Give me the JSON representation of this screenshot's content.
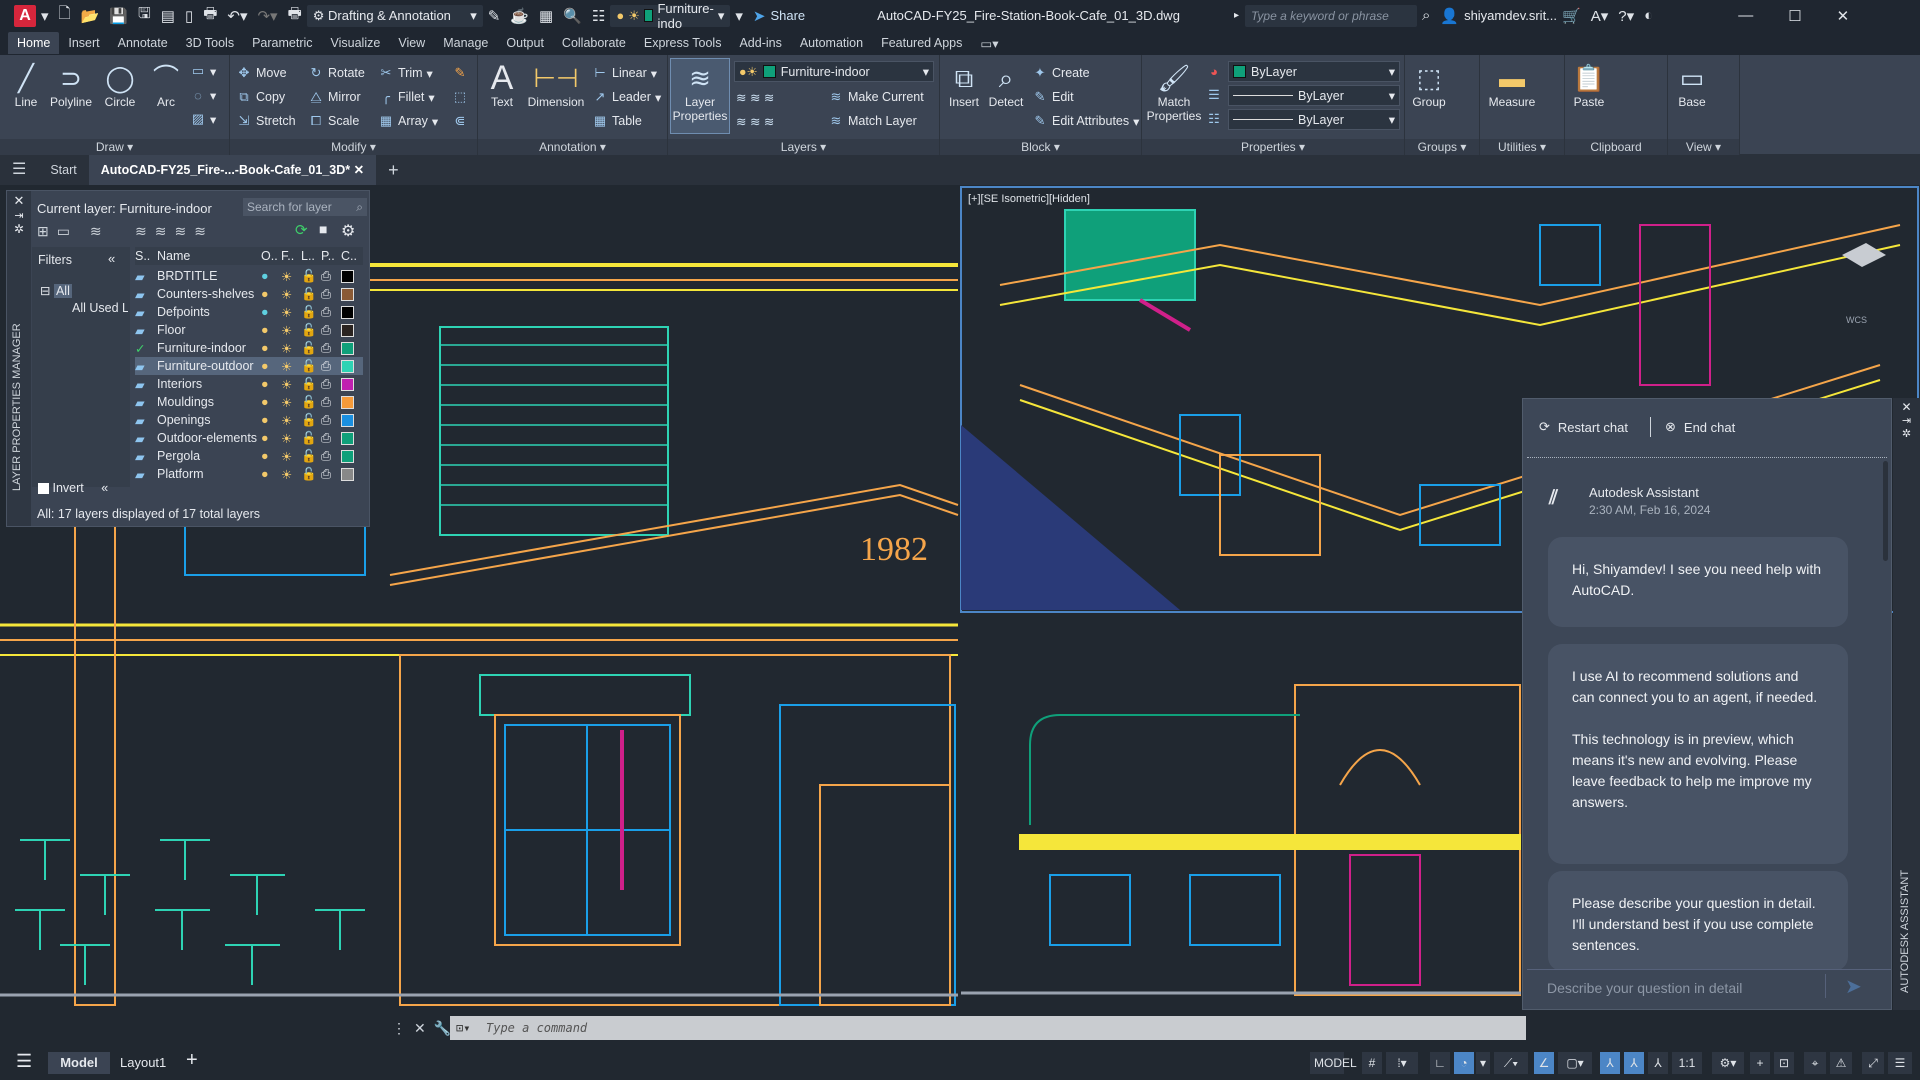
{
  "app": {
    "logo": "A",
    "workspace": "Drafting & Annotation",
    "layer_quick": "Furniture-indo",
    "share": "Share",
    "file_title": "AutoCAD-FY25_Fire-Station-Book-Cafe_01_3D.dwg",
    "search_placeholder": "Type a keyword or phrase",
    "user": "shiyamdev.srit..."
  },
  "ribbon_tabs": [
    "Home",
    "Insert",
    "Annotate",
    "3D Tools",
    "Parametric",
    "Visualize",
    "View",
    "Manage",
    "Output",
    "Collaborate",
    "Express Tools",
    "Add-ins",
    "Automation",
    "Featured Apps"
  ],
  "ribbon": {
    "draw": {
      "label": "Draw",
      "line": "Line",
      "polyline": "Polyline",
      "circle": "Circle",
      "arc": "Arc"
    },
    "modify": {
      "label": "Modify",
      "move": "Move",
      "rotate": "Rotate",
      "trim": "Trim",
      "copy": "Copy",
      "mirror": "Mirror",
      "fillet": "Fillet",
      "stretch": "Stretch",
      "scale": "Scale",
      "array": "Array"
    },
    "annotation": {
      "label": "Annotation",
      "text": "Text",
      "dimension": "Dimension",
      "linear": "Linear",
      "leader": "Leader",
      "table": "Table"
    },
    "layers": {
      "label": "Layers",
      "layer_properties": "Layer Properties",
      "current_layer": "Furniture-indoor",
      "make_current": "Make Current",
      "match_layer": "Match Layer"
    },
    "block": {
      "label": "Block",
      "insert": "Insert",
      "detect": "Detect",
      "create": "Create",
      "edit": "Edit",
      "edit_attributes": "Edit Attributes"
    },
    "properties": {
      "label": "Properties",
      "match_properties": "Match Properties",
      "color": "ByLayer",
      "linetype": "ByLayer",
      "lineweight": "ByLayer"
    },
    "groups": {
      "label": "Groups",
      "group": "Group"
    },
    "utilities": {
      "label": "Utilities",
      "measure": "Measure"
    },
    "clipboard": {
      "label": "Clipboard",
      "paste": "Paste"
    },
    "view": {
      "label": "View",
      "base": "Base"
    }
  },
  "doc_tabs": {
    "start": "Start",
    "active": "AutoCAD-FY25_Fire-...-Book-Cafe_01_3D*"
  },
  "layer_manager": {
    "side_title": "LAYER PROPERTIES MANAGER",
    "current_layer": "Current layer: Furniture-indoor",
    "search_placeholder": "Search for layer",
    "filters_label": "Filters",
    "filter_all": "All",
    "filter_all_used": "All Used Layers",
    "invert": "Invert",
    "columns": [
      "S..",
      "Name",
      "O..",
      "F..",
      "L..",
      "P..",
      "C.."
    ],
    "layers": [
      {
        "name": "BRDTITLE",
        "color": "#000000",
        "on_color": "#5fd0e0"
      },
      {
        "name": "Counters-shelves",
        "color": "#8a5a35",
        "on_color": "#f3c96a"
      },
      {
        "name": "Defpoints",
        "color": "#000000",
        "on_color": "#5fd0e0"
      },
      {
        "name": "Floor",
        "color": "#2a2320",
        "on_color": "#f3c96a"
      },
      {
        "name": "Furniture-indoor",
        "color": "#0fa07a",
        "on_color": "#f3c96a",
        "current": true
      },
      {
        "name": "Furniture-outdoor",
        "color": "#2ed3b4",
        "on_color": "#f3c96a",
        "selected": true
      },
      {
        "name": "Interiors",
        "color": "#c020b0",
        "on_color": "#f3c96a"
      },
      {
        "name": "Mouldings",
        "color": "#f59a3a",
        "on_color": "#f3c96a"
      },
      {
        "name": "Openings",
        "color": "#1a8fe0",
        "on_color": "#f3c96a"
      },
      {
        "name": "Outdoor-elements",
        "color": "#0fa07a",
        "on_color": "#f3c96a"
      },
      {
        "name": "Pergola",
        "color": "#0fa07a",
        "on_color": "#f3c96a"
      },
      {
        "name": "Platform",
        "color": "#888888",
        "on_color": "#f3c96a"
      }
    ],
    "status": "All: 17 layers displayed of 17 total layers"
  },
  "viewports": {
    "iso_label": "[+][SE Isometric][Hidden]",
    "wcs": "WCS",
    "year_text": "1982"
  },
  "chat": {
    "restart": "Restart chat",
    "end": "End chat",
    "sender": "Autodesk Assistant",
    "timestamp": "2:30 AM, Feb 16, 2024",
    "messages": [
      "Hi, Shiyamdev! I see you need help with AutoCAD.",
      "I use AI to recommend solutions and can connect you to an agent, if needed.\n\nThis technology is in preview, which means it's new and evolving. Please leave feedback to help me improve my answers.",
      "Please describe your question in detail. I'll understand best if you use complete sentences."
    ],
    "input_placeholder": "Describe your question in detail",
    "side_title": "AUTODESK ASSISTANT"
  },
  "command": {
    "placeholder": "Type a command"
  },
  "layout_tabs": [
    "Model",
    "Layout1"
  ],
  "status": {
    "model": "MODEL",
    "scale": "1:1"
  },
  "colors": {
    "accent": "#4c86c6",
    "yellow": "#f5e63a",
    "orange": "#f5a54a",
    "teal": "#2ed3b4",
    "blue": "#1a9fe8",
    "magenta": "#d0208a"
  }
}
